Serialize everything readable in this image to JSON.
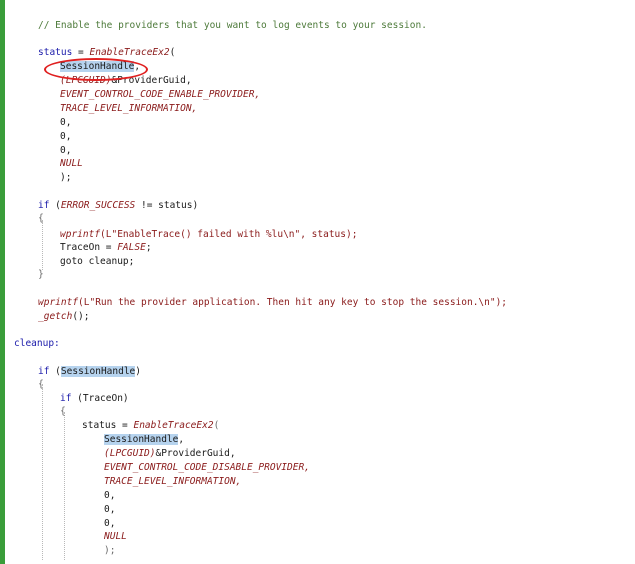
{
  "code": {
    "comment_enable": "// Enable the providers that you want to log events to your session.",
    "status_var": "status",
    "eq": " = ",
    "enable_fn": "EnableTraceEx2",
    "open_paren": "(",
    "session_handle": "SessionHandle",
    "comma": ",",
    "lpcguid": "(LPCGUID)",
    "provider_guid": "&ProviderGuid,",
    "enable_provider": "EVENT_CONTROL_CODE_ENABLE_PROVIDER,",
    "trace_level": "TRACE_LEVEL_INFORMATION,",
    "zero_comma": "0,",
    "null": "NULL",
    "close_semi": ");",
    "if_kw": "if",
    "if_cond_open": " (",
    "error_success": "ERROR_SUCCESS",
    "neq_status": " != status)",
    "lbrace": "{",
    "rbrace": "}",
    "wprintf": "wprintf",
    "wprintf_fail_args": "(L\"EnableTrace() failed with %lu\\n\", status);",
    "traceon_eq": "TraceOn = ",
    "false_kw": "FALSE",
    "semi": ";",
    "goto_cleanup": "goto cleanup;",
    "wprintf_run_args": "(L\"Run the provider application. Then hit any key to stop the session.\\n\");",
    "getch": "_getch",
    "getch_tail": "();",
    "cleanup_label": "cleanup:",
    "if_sessionhandle_open": " (",
    "if_sessionhandle_close": ")",
    "if_traceon": " (TraceOn)",
    "disable_provider": "EVENT_CONTROL_CODE_DISABLE_PROVIDER,",
    "close_semi_gray": ");",
    "status_assign": "status = "
  }
}
